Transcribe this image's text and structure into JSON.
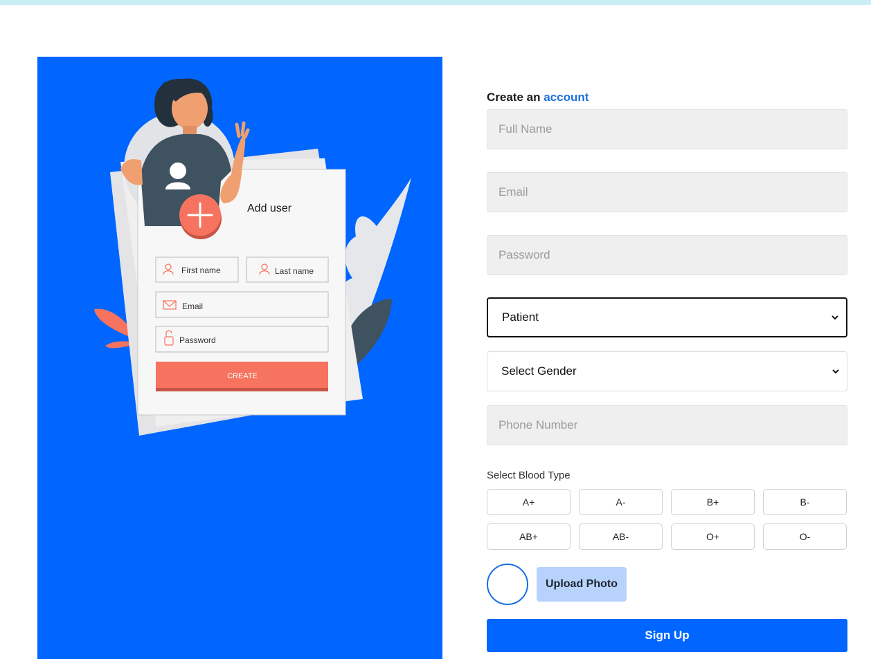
{
  "illustration": {
    "card_title": "Add user",
    "first_name": "First name",
    "last_name": "Last name",
    "email": "Email",
    "password": "Password",
    "create": "CREATE"
  },
  "form": {
    "heading_prefix": "Create an",
    "heading_accent": "account",
    "full_name_placeholder": "Full Name",
    "email_placeholder": "Email",
    "password_placeholder": "Password",
    "role_value": "Patient",
    "gender_value": "Select Gender",
    "phone_placeholder": "Phone Number",
    "blood_label": "Select Blood Type",
    "blood_types": [
      "A+",
      "A-",
      "B+",
      "B-",
      "AB+",
      "AB-",
      "O+",
      "O-"
    ],
    "upload_label": "Upload Photo",
    "signup_label": "Sign Up"
  },
  "colors": {
    "primary": "#0066ff",
    "accent_text": "#1a6fe0",
    "upload_bg": "#b8d3fb",
    "illustration_coral": "#f5735f"
  }
}
